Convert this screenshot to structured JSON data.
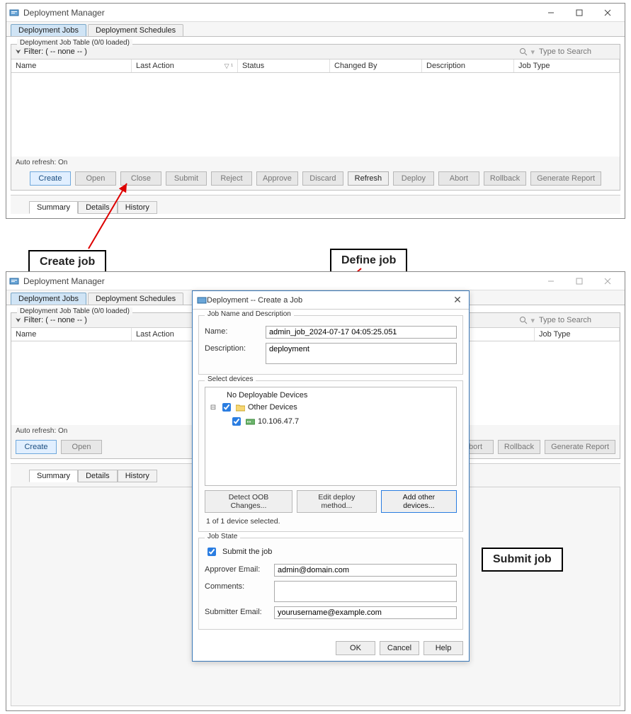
{
  "window": {
    "title": "Deployment Manager",
    "tabs": {
      "jobs": "Deployment Jobs",
      "schedules": "Deployment Schedules"
    },
    "group_title_template": "Deployment Job Table (0/0 loaded)",
    "filter_label": "Filter: ( -- none -- )",
    "search_placeholder": "Type to Search",
    "columns": {
      "name": "Name",
      "last_action": "Last Action",
      "status": "Status",
      "changed_by": "Changed By",
      "description": "Description",
      "job_type": "Job Type"
    },
    "auto_refresh": "Auto refresh: On",
    "buttons": {
      "create": "Create",
      "open": "Open",
      "close": "Close",
      "submit": "Submit",
      "reject": "Reject",
      "approve": "Approve",
      "discard": "Discard",
      "refresh": "Refresh",
      "deploy": "Deploy",
      "abort": "Abort",
      "rollback": "Rollback",
      "genreport": "Generate Report"
    },
    "bottom_tabs": {
      "summary": "Summary",
      "details": "Details",
      "history": "History"
    }
  },
  "callouts": {
    "create": "Create job",
    "define": "Define job",
    "submit": "Submit job"
  },
  "dialog": {
    "title": "Deployment -- Create a Job",
    "sections": {
      "name_desc": "Job Name and Description",
      "select_devices": "Select devices",
      "job_state": "Job State"
    },
    "fields": {
      "name_label": "Name:",
      "name_value": "admin_job_2024-07-17 04:05:25.051",
      "desc_label": "Description:",
      "desc_value": "deployment",
      "approver_label": "Approver Email:",
      "approver_value": "admin@domain.com",
      "comments_label": "Comments:",
      "comments_value": "",
      "submitter_label": "Submitter Email:",
      "submitter_value": "yourusername@example.com"
    },
    "tree": {
      "no_deployable": "No Deployable Devices",
      "other_devices": "Other Devices",
      "device_ip": "10.106.47.7"
    },
    "tree_buttons": {
      "detect": "Detect OOB Changes...",
      "editmethod": "Edit deploy method...",
      "addother": "Add other devices..."
    },
    "selected_count": "1 of 1 device selected.",
    "submit_checkbox": "Submit the job",
    "buttons": {
      "ok": "OK",
      "cancel": "Cancel",
      "help": "Help"
    }
  }
}
